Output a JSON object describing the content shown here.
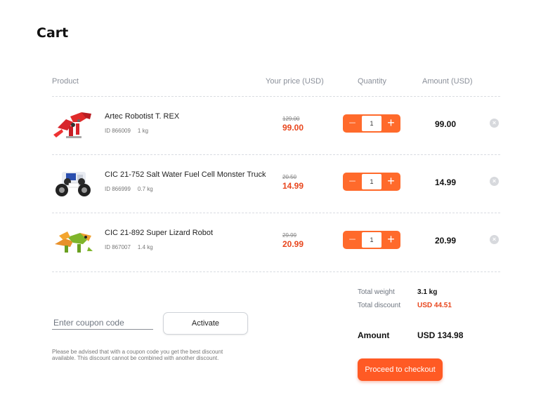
{
  "page": {
    "title": "Cart"
  },
  "columns": {
    "product": "Product",
    "price": "Your price (USD)",
    "quantity": "Quantity",
    "amount": "Amount (USD)"
  },
  "items": [
    {
      "name": "Artec Robotist T. REX",
      "id": "ID 866009",
      "weight": "1 kg",
      "old_price": "129.00",
      "price": "99.00",
      "quantity": "1",
      "amount": "99.00",
      "image": "red-robot-dinosaur"
    },
    {
      "name": "CIC 21-752 Salt Water Fuel Cell Monster Truck",
      "id": "ID 866999",
      "weight": "0.7 kg",
      "old_price": "20.50",
      "price": "14.99",
      "quantity": "1",
      "amount": "14.99",
      "image": "white-monster-truck"
    },
    {
      "name": "CIC 21-892 Super Lizard Robot",
      "id": "ID 867007",
      "weight": "1.4 kg",
      "old_price": "29.99",
      "price": "20.99",
      "quantity": "1",
      "amount": "20.99",
      "image": "green-lizard-robot"
    }
  ],
  "stepper": {
    "minus": "−",
    "plus": "+"
  },
  "remove_icon": "×",
  "summary": {
    "weight_label": "Total weight",
    "weight_value": "3.1 kg",
    "discount_label": "Total discount",
    "discount_value": "USD 44.51",
    "amount_label": "Amount",
    "amount_value": "USD 134.98"
  },
  "coupon": {
    "placeholder": "Enter coupon code",
    "button": "Activate",
    "note": "Please be advised that with a coupon code you get the best discount available. This discount cannot be combined with another discount."
  },
  "checkout": {
    "button": "Proceed to checkout"
  },
  "colors": {
    "accent": "#ff6a2b",
    "price_red": "#e8461d"
  }
}
